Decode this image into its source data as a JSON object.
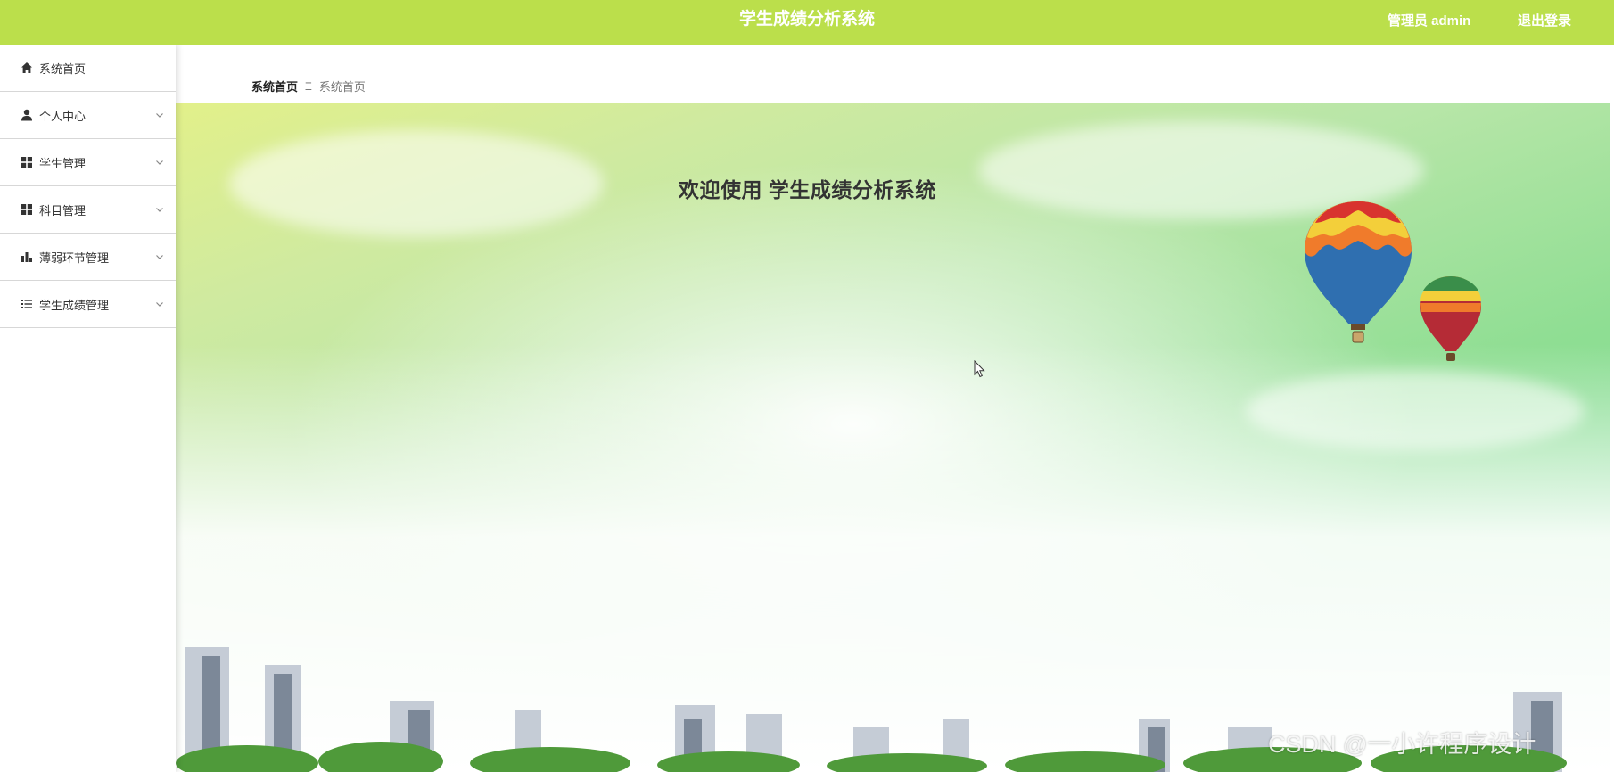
{
  "header": {
    "title": "学生成绩分析系统",
    "user_label": "管理员 admin",
    "logout_label": "退出登录",
    "color": "#bbdf4b"
  },
  "sidebar": {
    "items": [
      {
        "label": "系统首页",
        "icon": "home-icon",
        "expandable": false
      },
      {
        "label": "个人中心",
        "icon": "user-icon",
        "expandable": true
      },
      {
        "label": "学生管理",
        "icon": "grid-icon",
        "expandable": true
      },
      {
        "label": "科目管理",
        "icon": "grid-icon",
        "expandable": true
      },
      {
        "label": "薄弱环节管理",
        "icon": "bar-chart-icon",
        "expandable": true
      },
      {
        "label": "学生成绩管理",
        "icon": "list-icon",
        "expandable": true
      }
    ]
  },
  "breadcrumb": {
    "first": "系统首页",
    "separator": "Ξ",
    "second": "系统首页"
  },
  "main": {
    "welcome": "欢迎使用 学生成绩分析系统"
  },
  "watermark": "CSDN @一小许程序设计"
}
